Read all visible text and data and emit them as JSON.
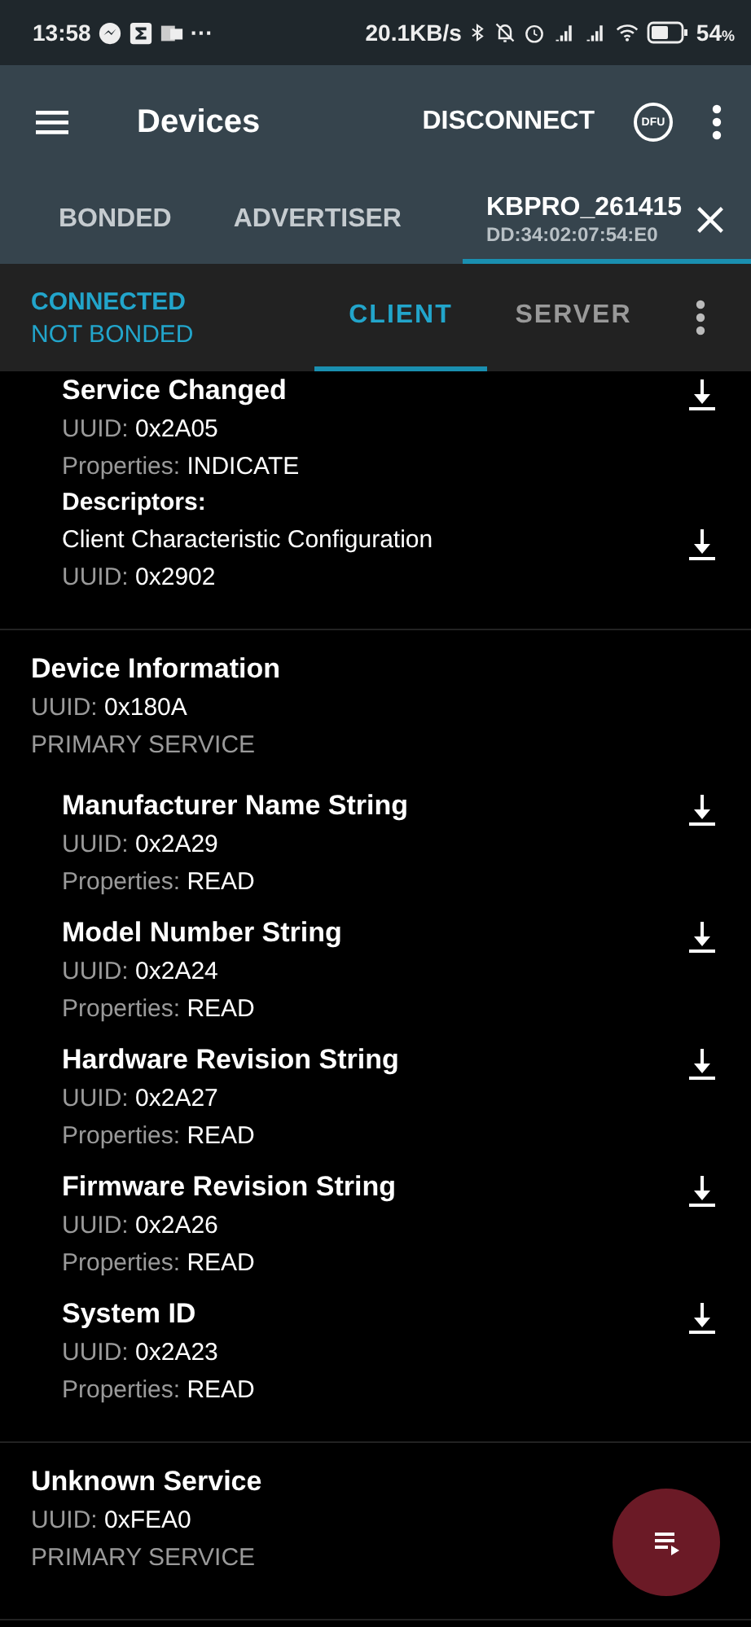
{
  "status_bar": {
    "time": "13:58",
    "more": "···",
    "network_speed": "20.1KB/s",
    "battery": "54",
    "battery_unit": "%"
  },
  "app_bar": {
    "title": "Devices",
    "action": "DISCONNECT",
    "dfu_label": "DFU"
  },
  "device_tabs": [
    {
      "label": "BONDED",
      "selected": false
    },
    {
      "label": "ADVERTISER",
      "selected": false
    },
    {
      "label": "KBPRO_261415",
      "address": "DD:34:02:07:54:E0",
      "selected": true
    }
  ],
  "connection": {
    "state": "CONNECTED",
    "bond": "NOT BONDED"
  },
  "view_tabs": [
    {
      "label": "CLIENT",
      "selected": true
    },
    {
      "label": "SERVER",
      "selected": false
    }
  ],
  "services": [
    {
      "characteristics": [
        {
          "name": "Service Changed",
          "uuid_label": "UUID:",
          "uuid": "0x2A05",
          "properties_label": "Properties:",
          "properties": "INDICATE",
          "descriptors_label": "Descriptors:",
          "descriptors": [
            {
              "name": "Client Characteristic Configuration",
              "uuid_label": "UUID:",
              "uuid": "0x2902"
            }
          ]
        }
      ]
    },
    {
      "name": "Device Information",
      "uuid_label": "UUID:",
      "uuid": "0x180A",
      "type": "PRIMARY SERVICE",
      "characteristics": [
        {
          "name": "Manufacturer Name String",
          "uuid_label": "UUID:",
          "uuid": "0x2A29",
          "properties_label": "Properties:",
          "properties": "READ"
        },
        {
          "name": "Model Number String",
          "uuid_label": "UUID:",
          "uuid": "0x2A24",
          "properties_label": "Properties:",
          "properties": "READ"
        },
        {
          "name": "Hardware Revision String",
          "uuid_label": "UUID:",
          "uuid": "0x2A27",
          "properties_label": "Properties:",
          "properties": "READ"
        },
        {
          "name": "Firmware Revision String",
          "uuid_label": "UUID:",
          "uuid": "0x2A26",
          "properties_label": "Properties:",
          "properties": "READ"
        },
        {
          "name": "System ID",
          "uuid_label": "UUID:",
          "uuid": "0x2A23",
          "properties_label": "Properties:",
          "properties": "READ"
        }
      ]
    },
    {
      "name": "Unknown Service",
      "uuid_label": "UUID:",
      "uuid": "0xFEA0",
      "type": "PRIMARY SERVICE"
    }
  ]
}
